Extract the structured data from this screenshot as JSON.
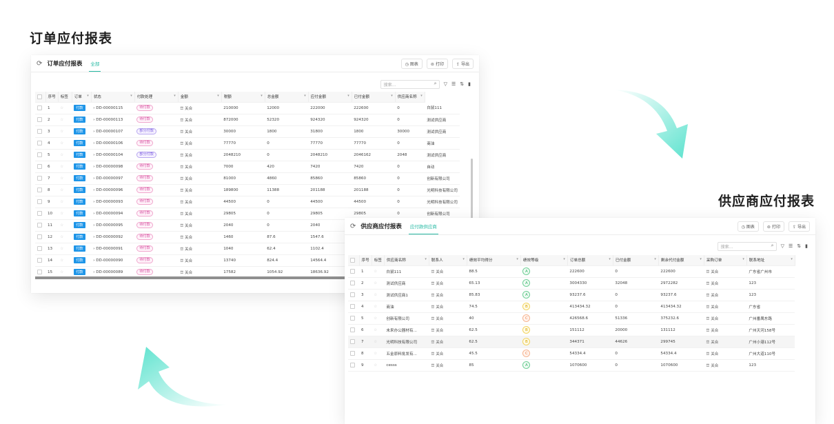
{
  "headings": {
    "left": "订单应付报表",
    "right": "供应商应付报表"
  },
  "colors": {
    "accent": "#25b9a3",
    "tag_button": "#1e95e8",
    "arrow": "#5fe3cf"
  },
  "w1": {
    "title": "订单应付报表",
    "tab": "全部",
    "actions": [
      {
        "icon": "chart-icon",
        "label": "图表"
      },
      {
        "icon": "print-icon",
        "label": "打印"
      },
      {
        "icon": "export-icon",
        "label": "导出"
      }
    ],
    "search_placeholder": "搜索...",
    "headers": [
      "序号",
      "标签",
      "订单",
      "状态",
      "付款处理",
      "金额",
      "税额",
      "总金额",
      "应付金额",
      "已付金额",
      "供应商名称"
    ],
    "rows": [
      {
        "idx": "1",
        "tag": "付款",
        "order": "DD-00000115",
        "status": "待付款",
        "status_color": "pink",
        "rel": "关合",
        "amount": "210000",
        "tax": "12000",
        "total": "222000",
        "payable": "222600",
        "paid": "0",
        "supplier": "白鼠111"
      },
      {
        "idx": "2",
        "tag": "付款",
        "order": "DD-00000113",
        "status": "待付款",
        "status_color": "pink",
        "rel": "关合",
        "amount": "872000",
        "tax": "52320",
        "total": "924320",
        "payable": "924320",
        "paid": "0",
        "supplier": "测试供应商"
      },
      {
        "idx": "3",
        "tag": "付款",
        "order": "DD-00000107",
        "status": "部分付款",
        "status_color": "purple",
        "rel": "关合",
        "amount": "30000",
        "tax": "1800",
        "total": "31800",
        "payable": "1800",
        "paid": "30000",
        "supplier": "测试供应商"
      },
      {
        "idx": "4",
        "tag": "付款",
        "order": "DD-00000106",
        "status": "待付款",
        "status_color": "pink",
        "rel": "关合",
        "amount": "77770",
        "tax": "0",
        "total": "77770",
        "payable": "77770",
        "paid": "0",
        "supplier": "商油"
      },
      {
        "idx": "5",
        "tag": "付款",
        "order": "DD-00000104",
        "status": "部分付款",
        "status_color": "purple",
        "rel": "关合",
        "amount": "2048210",
        "tax": "0",
        "total": "2048210",
        "payable": "2046162",
        "paid": "2048",
        "supplier": "测试供应商"
      },
      {
        "idx": "6",
        "tag": "付款",
        "order": "DD-00000098",
        "status": "待付款",
        "status_color": "pink",
        "rel": "关合",
        "amount": "7000",
        "tax": "420",
        "total": "7420",
        "payable": "7420",
        "paid": "0",
        "supplier": "自动"
      },
      {
        "idx": "7",
        "tag": "付款",
        "order": "DD-00000097",
        "status": "待付款",
        "status_color": "pink",
        "rel": "关合",
        "amount": "81000",
        "tax": "4860",
        "total": "85860",
        "payable": "85860",
        "paid": "0",
        "supplier": "创新有限公司"
      },
      {
        "idx": "8",
        "tag": "付款",
        "order": "DD-00000096",
        "status": "待付款",
        "status_color": "pink",
        "rel": "关合",
        "amount": "189800",
        "tax": "11388",
        "total": "201188",
        "payable": "201188",
        "paid": "0",
        "supplier": "光明科技有限公司"
      },
      {
        "idx": "9",
        "tag": "付款",
        "order": "DD-00000093",
        "status": "待付款",
        "status_color": "pink",
        "rel": "关合",
        "amount": "44500",
        "tax": "0",
        "total": "44500",
        "payable": "44500",
        "paid": "0",
        "supplier": "光明科技有限公司"
      },
      {
        "idx": "10",
        "tag": "付款",
        "order": "DD-00000094",
        "status": "待付款",
        "status_color": "pink",
        "rel": "关合",
        "amount": "29805",
        "tax": "0",
        "total": "29805",
        "payable": "29805",
        "paid": "0",
        "supplier": "创新有限公司"
      },
      {
        "idx": "11",
        "tag": "付款",
        "order": "DD-00000095",
        "status": "待付款",
        "status_color": "pink",
        "rel": "关合",
        "amount": "2040",
        "tax": "0",
        "total": "2040",
        "payable": "",
        "paid": "",
        "supplier": ""
      },
      {
        "idx": "12",
        "tag": "付款",
        "order": "DD-00000092",
        "status": "待付款",
        "status_color": "pink",
        "rel": "关合",
        "amount": "1460",
        "tax": "87.6",
        "total": "1547.6",
        "payable": "",
        "paid": "",
        "supplier": ""
      },
      {
        "idx": "13",
        "tag": "付款",
        "order": "DD-00000091",
        "status": "待付款",
        "status_color": "pink",
        "rel": "关合",
        "amount": "1040",
        "tax": "62.4",
        "total": "1102.4",
        "payable": "",
        "paid": "",
        "supplier": ""
      },
      {
        "idx": "14",
        "tag": "付款",
        "order": "DD-00000090",
        "status": "待付款",
        "status_color": "pink",
        "rel": "关合",
        "amount": "13740",
        "tax": "824.4",
        "total": "14564.4",
        "payable": "",
        "paid": "",
        "supplier": ""
      },
      {
        "idx": "15",
        "tag": "付款",
        "order": "DD-00000089",
        "status": "待付款",
        "status_color": "pink",
        "rel": "关合",
        "amount": "17582",
        "tax": "1054.92",
        "total": "18636.92",
        "payable": "",
        "paid": "",
        "supplier": ""
      }
    ]
  },
  "w2": {
    "title": "供应商应付报表",
    "tab": "应付款供应商",
    "actions": [
      {
        "icon": "chart-icon",
        "label": "图表"
      },
      {
        "icon": "print-icon",
        "label": "打印"
      },
      {
        "icon": "export-icon",
        "label": "导出"
      }
    ],
    "search_placeholder": "搜索...",
    "headers": [
      "序号",
      "标签",
      "供应商名称",
      "联系人",
      "绩效平均得分",
      "绩效等级",
      "订单总额",
      "已付金额",
      "剩余代付金额",
      "采购订单",
      "联系地址"
    ],
    "rows": [
      {
        "idx": "1",
        "name": "白鼠111",
        "contact": "关合",
        "score": "88.5",
        "grade": "A",
        "total": "222600",
        "paid": "0",
        "remain": "222600",
        "po": "关合",
        "addr": "广东省广州市"
      },
      {
        "idx": "2",
        "name": "测试供应商",
        "contact": "关合",
        "score": "65.13",
        "grade": "A",
        "total": "3004330",
        "paid": "32048",
        "remain": "2972282",
        "po": "关合",
        "addr": "123"
      },
      {
        "idx": "3",
        "name": "测试供应商1",
        "contact": "关合",
        "score": "85.83",
        "grade": "A",
        "total": "93237.6",
        "paid": "0",
        "remain": "93237.6",
        "po": "关合",
        "addr": "123"
      },
      {
        "idx": "4",
        "name": "商油",
        "contact": "关合",
        "score": "74.5",
        "grade": "B",
        "total": "413434.32",
        "paid": "0",
        "remain": "413434.32",
        "po": "关合",
        "addr": "广东省"
      },
      {
        "idx": "5",
        "name": "创新有限公司",
        "contact": "关合",
        "score": "40",
        "grade": "C",
        "total": "426568.6",
        "paid": "51336",
        "remain": "375232.6",
        "po": "关合",
        "addr": "广州番禺东路"
      },
      {
        "idx": "6",
        "name": "未来办公器材有...",
        "contact": "关合",
        "score": "62.5",
        "grade": "B",
        "total": "151112",
        "paid": "20000",
        "remain": "131112",
        "po": "关合",
        "addr": "广州天河158号"
      },
      {
        "idx": "7",
        "name": "光明科技有限公司",
        "contact": "关合",
        "score": "62.5",
        "grade": "B",
        "total": "344371",
        "paid": "44626",
        "remain": "299745",
        "po": "关合",
        "addr": "广州小港112号"
      },
      {
        "idx": "8",
        "name": "五金原料批发有...",
        "contact": "关合",
        "score": "45.5",
        "grade": "C",
        "total": "54334.4",
        "paid": "0",
        "remain": "54334.4",
        "po": "关合",
        "addr": "广州大道110号"
      },
      {
        "idx": "9",
        "name": "cesss",
        "contact": "关合",
        "score": "85",
        "grade": "A",
        "total": "1070600",
        "paid": "0",
        "remain": "1070600",
        "po": "关合",
        "addr": "123"
      }
    ]
  }
}
